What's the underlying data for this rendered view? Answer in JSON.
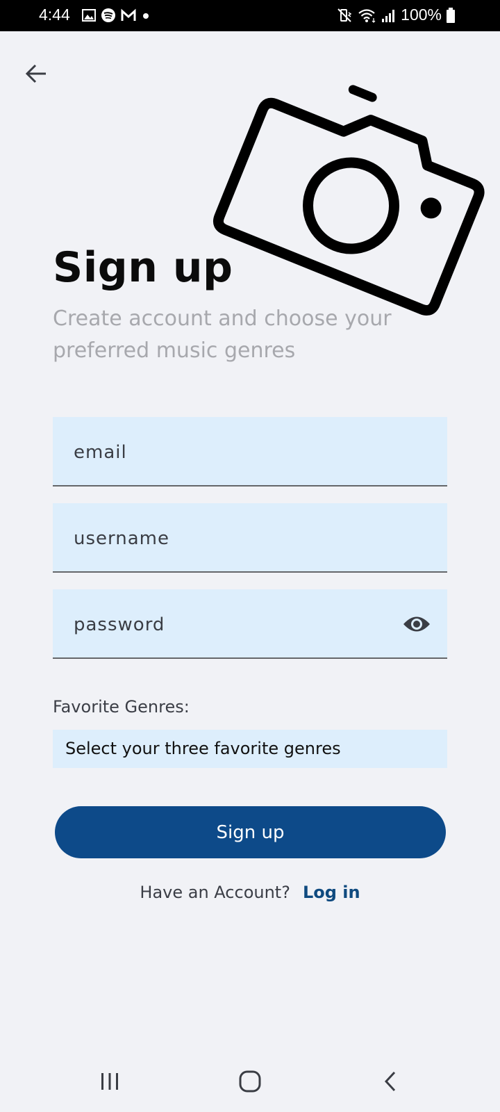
{
  "status_bar": {
    "time": "4:44",
    "battery": "100%",
    "icons_left": [
      "gallery-icon",
      "spotify-icon",
      "gmail-icon",
      "dot-icon"
    ],
    "icons_right": [
      "mute-vibrate-icon",
      "wifi-icon",
      "signal-icon",
      "battery-icon"
    ]
  },
  "header": {
    "back_icon": "arrow-left-icon",
    "illustration": "camera-icon"
  },
  "main": {
    "title": "Sign up",
    "subtitle": "Create account and choose your preferred music genres",
    "fields": {
      "email_placeholder": "email",
      "username_placeholder": "username",
      "password_placeholder": "password",
      "password_toggle_icon": "eye-icon"
    },
    "genres": {
      "label": "Favorite Genres:",
      "select_text": "Select your three favorite genres"
    },
    "signup_button": "Sign up",
    "login_prompt": "Have an Account?",
    "login_link": "Log in"
  },
  "colors": {
    "background": "#f1f2f6",
    "field_background": "#ddeefc",
    "primary_button": "#0d4a89",
    "link": "#0f4a7f"
  },
  "nav_bar": {
    "buttons": [
      "recents-icon",
      "home-icon",
      "back-icon"
    ]
  }
}
